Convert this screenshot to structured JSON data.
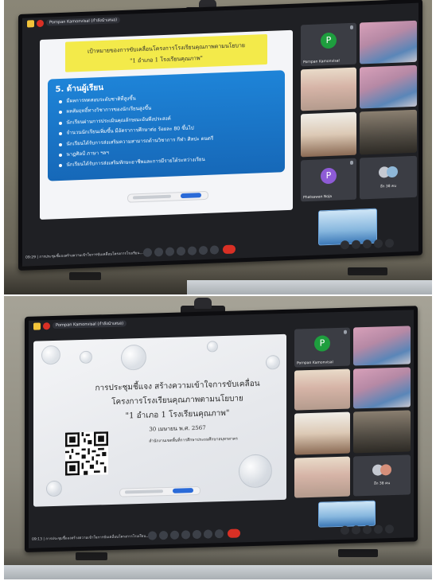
{
  "top_photo": {
    "meeting_chip": "Pornpan Kamonvisal (กำลังนำเสนอ)",
    "slide": {
      "header_line1": "เป้าหมายของการขับเคลื่อนโครงการโรงเรียนคุณภาพตามนโยบาย",
      "header_line2": "\"1 อำเภอ 1 โรงเรียนคุณภาพ\"",
      "box_title": "5. ด้านผู้เรียน",
      "bullets": [
        "มีผลการทดสอบระดับชาติที่สูงขึ้น",
        "ผลสัมฤทธิ์ทางวิชาการของนักเรียนสูงขึ้น",
        "นักเรียนผ่านการประเมินคุณลักษณะอันพึงประสงค์",
        "จำนวนนักเรียนเพิ่มขึ้น มีอัตราการศึกษาต่อ ร้อยละ 80 ขึ้นไป",
        "นักเรียนได้รับการส่งเสริมความสามารถด้านวิชาการ กีฬา ศิลปะ ดนตรี",
        "นาฏศิลป์ ภาษา ฯลฯ",
        "นักเรียนได้รับการส่งเสริมทักษะอาชีพและการมีรายได้ระหว่างเรียน"
      ]
    },
    "participants": [
      {
        "name": "Pornpan Kamonvisal",
        "initial": "P",
        "color": "#1e9e3e"
      },
      {
        "name": "",
        "initial": "",
        "color": ""
      },
      {
        "name": "",
        "initial": "",
        "color": ""
      },
      {
        "name": "",
        "initial": "",
        "color": ""
      },
      {
        "name": "",
        "initial": "",
        "color": ""
      },
      {
        "name": "",
        "initial": "",
        "color": ""
      },
      {
        "name": "Phatsawan Noja",
        "initial": "P",
        "color": "#8e5bd6"
      },
      {
        "name": "อีก 38 คน",
        "initial": "",
        "color": ""
      }
    ],
    "meeting_code": "09:29 | การประชุมชี้แจงสร้างความเข้าใจการขับเคลื่อนโครงการโรงเรียน..."
  },
  "bottom_photo": {
    "meeting_chip": "Pornpan Kamonvisal (กำลังนำเสนอ)",
    "slide": {
      "line1": "การประชุมชี้แจง สร้างความเข้าใจการขับเคลื่อน",
      "line2": "โครงการโรงเรียนคุณภาพตามนโยบาย",
      "line3": "\"1 อำเภอ 1 โรงเรียนคุณภาพ\"",
      "date": "30 เมษายน พ.ศ. 2567",
      "organizer": "สำนักงานเขตพื้นที่การศึกษาประถมศึกษาสมุทรสาคร"
    },
    "participants": [
      {
        "name": "Pornpan Kamonvisal",
        "initial": "P",
        "color": "#1e9e3e"
      },
      {
        "name": "",
        "initial": "",
        "color": ""
      },
      {
        "name": "",
        "initial": "",
        "color": ""
      },
      {
        "name": "",
        "initial": "",
        "color": ""
      },
      {
        "name": "",
        "initial": "",
        "color": ""
      },
      {
        "name": "",
        "initial": "",
        "color": ""
      },
      {
        "name": "",
        "initial": "",
        "color": ""
      },
      {
        "name": "อีก 38 คน",
        "initial": "",
        "color": ""
      }
    ],
    "meeting_code": "09:13 | การประชุมชี้แจงสร้างความเข้าใจการขับเคลื่อนโครงการโรงเรียน..."
  },
  "colors": {
    "end_call": "#d93025",
    "slide_header_yellow": "#f3ea4a",
    "slide_box_blue": "#1e84d8"
  },
  "icons": [
    "camera-icon",
    "mic-icon",
    "leave-call-icon",
    "hand-raise-icon",
    "present-icon",
    "captions-icon",
    "more-icon",
    "info-icon",
    "people-icon",
    "chat-icon",
    "activities-icon",
    "lock-icon"
  ]
}
